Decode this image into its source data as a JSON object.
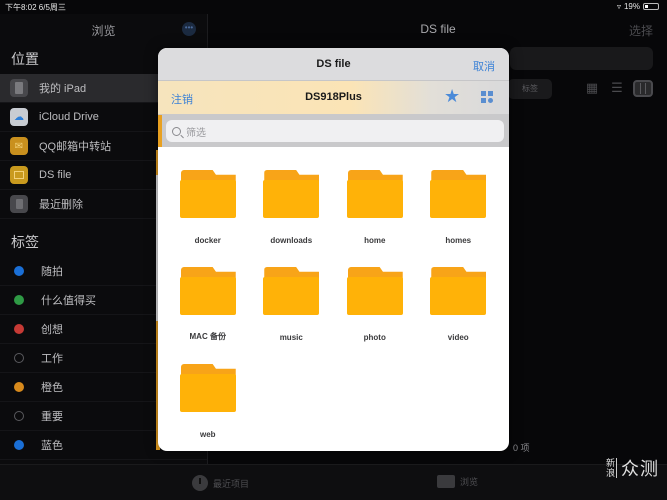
{
  "status_bar": {
    "time_date": "下午8:02  6/5周三",
    "battery": "19%"
  },
  "sidebar": {
    "title": "浏览",
    "more_icon": "ellipsis-icon",
    "locations_title": "位置",
    "locations": [
      {
        "label": "我的 iPad",
        "icon": "ipad-icon",
        "selected": true
      },
      {
        "label": "iCloud Drive",
        "icon": "icloud-icon"
      },
      {
        "label": "QQ邮箱中转站",
        "icon": "mail-icon"
      },
      {
        "label": "DS file",
        "icon": "dsfile-icon"
      },
      {
        "label": "最近删除",
        "icon": "trash-icon"
      }
    ],
    "tags_title": "标签",
    "tags": [
      {
        "label": "随拍",
        "color": "#1a6fd6"
      },
      {
        "label": "什么值得买",
        "color": "#2f9a45"
      },
      {
        "label": "创想",
        "color": "#c63a35"
      },
      {
        "label": "工作",
        "color": ""
      },
      {
        "label": "橙色",
        "color": "#d88a1c"
      },
      {
        "label": "重要",
        "color": ""
      },
      {
        "label": "蓝色",
        "color": "#1a6fd6"
      }
    ]
  },
  "main": {
    "title": "DS file",
    "select_label": "选择",
    "tags_button": "标签",
    "item_count": "0 项"
  },
  "tabbar": {
    "recent": "最近项目",
    "browse": "浏览"
  },
  "watermark": {
    "small": "新浪",
    "large": "众测"
  },
  "modal": {
    "title": "DS file",
    "cancel": "取消",
    "nav": {
      "logout": "注销",
      "title": "DS918Plus"
    },
    "search_placeholder": "筛选",
    "folders": [
      "docker",
      "downloads",
      "home",
      "homes",
      "MAC 备份",
      "music",
      "photo",
      "video",
      "web"
    ]
  },
  "colors": {
    "accent_blue": "#3c82d6",
    "folder": "#ffb208",
    "nas_orange": "#e8a020"
  }
}
